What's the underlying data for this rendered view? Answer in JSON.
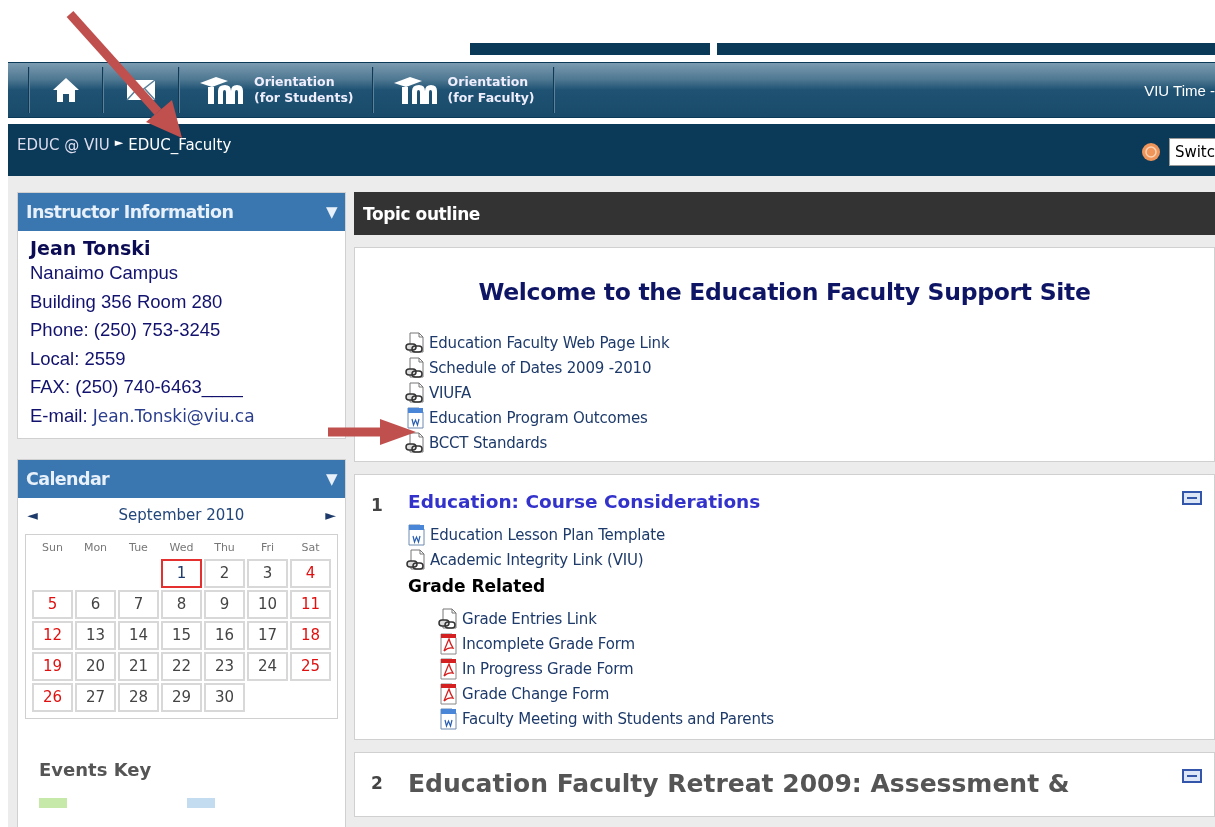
{
  "navbar": {
    "items": [
      {
        "kind": "home"
      },
      {
        "kind": "mail"
      },
      {
        "kind": "orientation",
        "label_lines": [
          "Orientation",
          "(for Students)"
        ]
      },
      {
        "kind": "orientation",
        "label_lines": [
          "Orientation",
          "(for Faculty)"
        ]
      }
    ],
    "time": "VIU Time -"
  },
  "breadcrumb": {
    "items": [
      "EDUC @ VIU",
      "EDUC_Faculty"
    ],
    "separator": "►",
    "switch_value": "Switc"
  },
  "instructor_block": {
    "title": "Instructor Information",
    "collapse": "▼",
    "name": "Jean Tonski",
    "lines": [
      "Nanaimo Campus",
      "Building 356 Room 280",
      "Phone: (250) 753-3245",
      "Local: 2559",
      "FAX: (250) 740-6463____"
    ],
    "email_label": "E-mail:",
    "email": "Jean.Tonski@viu.ca"
  },
  "calendar": {
    "title": "Calendar",
    "collapse": "▼",
    "prev": "◄",
    "next": "►",
    "month": "September 2010",
    "weekdays": [
      "Sun",
      "Mon",
      "Tue",
      "Wed",
      "Thu",
      "Fri",
      "Sat"
    ],
    "weeks": [
      [
        {
          "kind": "empty"
        },
        {
          "kind": "empty"
        },
        {
          "kind": "empty"
        },
        {
          "kind": "day",
          "day": "1",
          "weekend": false,
          "today": true
        },
        {
          "kind": "day",
          "day": "2",
          "weekend": false,
          "today": false
        },
        {
          "kind": "day",
          "day": "3",
          "weekend": false,
          "today": false
        },
        {
          "kind": "day",
          "day": "4",
          "weekend": true,
          "today": false
        }
      ],
      [
        {
          "kind": "day",
          "day": "5",
          "weekend": true,
          "today": false
        },
        {
          "kind": "day",
          "day": "6",
          "weekend": false,
          "today": false
        },
        {
          "kind": "day",
          "day": "7",
          "weekend": false,
          "today": false
        },
        {
          "kind": "day",
          "day": "8",
          "weekend": false,
          "today": false
        },
        {
          "kind": "day",
          "day": "9",
          "weekend": false,
          "today": false
        },
        {
          "kind": "day",
          "day": "10",
          "weekend": false,
          "today": false
        },
        {
          "kind": "day",
          "day": "11",
          "weekend": true,
          "today": false
        }
      ],
      [
        {
          "kind": "day",
          "day": "12",
          "weekend": true,
          "today": false
        },
        {
          "kind": "day",
          "day": "13",
          "weekend": false,
          "today": false
        },
        {
          "kind": "day",
          "day": "14",
          "weekend": false,
          "today": false
        },
        {
          "kind": "day",
          "day": "15",
          "weekend": false,
          "today": false
        },
        {
          "kind": "day",
          "day": "16",
          "weekend": false,
          "today": false
        },
        {
          "kind": "day",
          "day": "17",
          "weekend": false,
          "today": false
        },
        {
          "kind": "day",
          "day": "18",
          "weekend": true,
          "today": false
        }
      ],
      [
        {
          "kind": "day",
          "day": "19",
          "weekend": true,
          "today": false
        },
        {
          "kind": "day",
          "day": "20",
          "weekend": false,
          "today": false
        },
        {
          "kind": "day",
          "day": "21",
          "weekend": false,
          "today": false
        },
        {
          "kind": "day",
          "day": "22",
          "weekend": false,
          "today": false
        },
        {
          "kind": "day",
          "day": "23",
          "weekend": false,
          "today": false
        },
        {
          "kind": "day",
          "day": "24",
          "weekend": false,
          "today": false
        },
        {
          "kind": "day",
          "day": "25",
          "weekend": true,
          "today": false
        }
      ],
      [
        {
          "kind": "day",
          "day": "26",
          "weekend": true,
          "today": false
        },
        {
          "kind": "day",
          "day": "27",
          "weekend": false,
          "today": false
        },
        {
          "kind": "day",
          "day": "28",
          "weekend": false,
          "today": false
        },
        {
          "kind": "day",
          "day": "29",
          "weekend": false,
          "today": false
        },
        {
          "kind": "day",
          "day": "30",
          "weekend": false,
          "today": false
        },
        {
          "kind": "empty"
        },
        {
          "kind": "empty"
        }
      ]
    ],
    "events_key": {
      "title": "Events Key",
      "swatches": [
        {
          "color": "#c6e8a8"
        },
        {
          "color": "#c4dcef"
        }
      ]
    }
  },
  "topic_outline": {
    "title": "Topic outline",
    "sections": [
      {
        "kind": "intro",
        "heading": "Welcome to the Education Faculty Support Site",
        "items": [
          {
            "kind": "link",
            "text": "Education Faculty Web Page Link"
          },
          {
            "kind": "link",
            "text": "Schedule of Dates 2009 -2010"
          },
          {
            "kind": "link",
            "text": "VIUFA"
          },
          {
            "kind": "doc",
            "text": "Education Program Outcomes"
          },
          {
            "kind": "link",
            "text": "BCCT Standards"
          }
        ]
      },
      {
        "kind": "topic",
        "number": "1",
        "heading": "Education: Course Considerations",
        "items": [
          {
            "kind": "doc",
            "text": "Education Lesson Plan Template"
          },
          {
            "kind": "link",
            "text": "Academic Integrity Link (VIU)"
          },
          {
            "kind": "label",
            "text": "Grade Related",
            "children": [
              {
                "kind": "link",
                "text": "Grade Entries Link"
              },
              {
                "kind": "pdf",
                "text": "Incomplete Grade Form"
              },
              {
                "kind": "pdf",
                "text": "In Progress Grade Form"
              },
              {
                "kind": "pdf",
                "text": "Grade Change Form"
              },
              {
                "kind": "doc",
                "text": "Faculty Meeting with Students and Parents"
              }
            ]
          }
        ]
      },
      {
        "kind": "topic",
        "number": "2",
        "heading": "Education Faculty Retreat 2009: Assessment &",
        "dim": true
      }
    ]
  }
}
